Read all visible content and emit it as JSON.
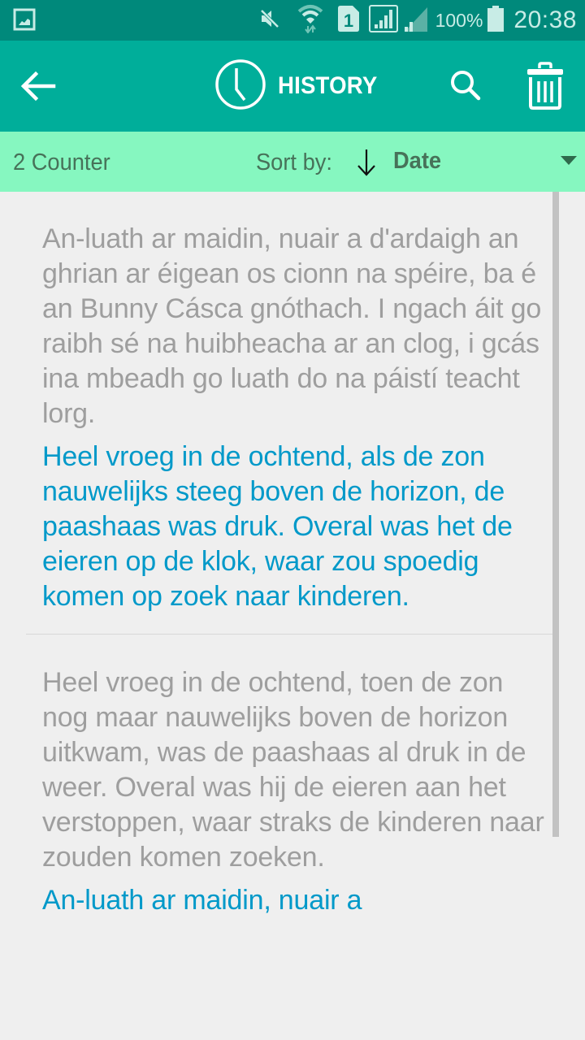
{
  "status_bar": {
    "left_icon": "gallery-notification-icon",
    "icons": [
      "mute-icon",
      "wifi-icon",
      "sim-1-icon",
      "signal-sim1-icon",
      "signal-sim2-icon"
    ],
    "battery_percent": "100%",
    "battery_icon": "battery-full-icon",
    "time": "20:38"
  },
  "app_bar": {
    "back_icon": "back-arrow-icon",
    "title_icon": "clock-icon",
    "title": "HISTORY",
    "search_icon": "search-icon",
    "delete_icon": "trash-icon"
  },
  "sort_bar": {
    "counter": "2 Counter",
    "sort_label": "Sort by:",
    "sort_direction": "descending",
    "sort_direction_icon": "arrow-down-icon",
    "sort_value": "Date",
    "dropdown_icon": "dropdown-triangle-icon"
  },
  "colors": {
    "status_bar": "#00897b",
    "app_bar": "#00ae9a",
    "sort_bar": "#86f7c0",
    "source_text": "#9e9e9e",
    "translation_text": "#0099c9",
    "background": "#efefef"
  },
  "history": [
    {
      "source": "An-luath ar maidin, nuair a d'ardaigh an ghrian ar éigean os cionn na spéire, ba é an Bunny Cásca gnóthach. I ngach áit go raibh sé na huibheacha ar an clog, i gcás ina mbeadh go luath do na páistí teacht lorg.",
      "translation": "Heel vroeg in de ochtend, als de zon nauwelijks steeg boven de horizon, de paashaas was druk. Overal was het de eieren op de klok, waar zou spoedig komen op zoek naar kinderen."
    },
    {
      "source": "Heel vroeg in de ochtend, toen de zon nog maar nauwelijks boven de horizon uitkwam, was de paashaas al druk in de weer. Overal was hij de eieren aan het verstoppen, waar straks de kinderen naar zouden komen zoeken.",
      "translation": "An-luath ar maidin, nuair a"
    }
  ]
}
